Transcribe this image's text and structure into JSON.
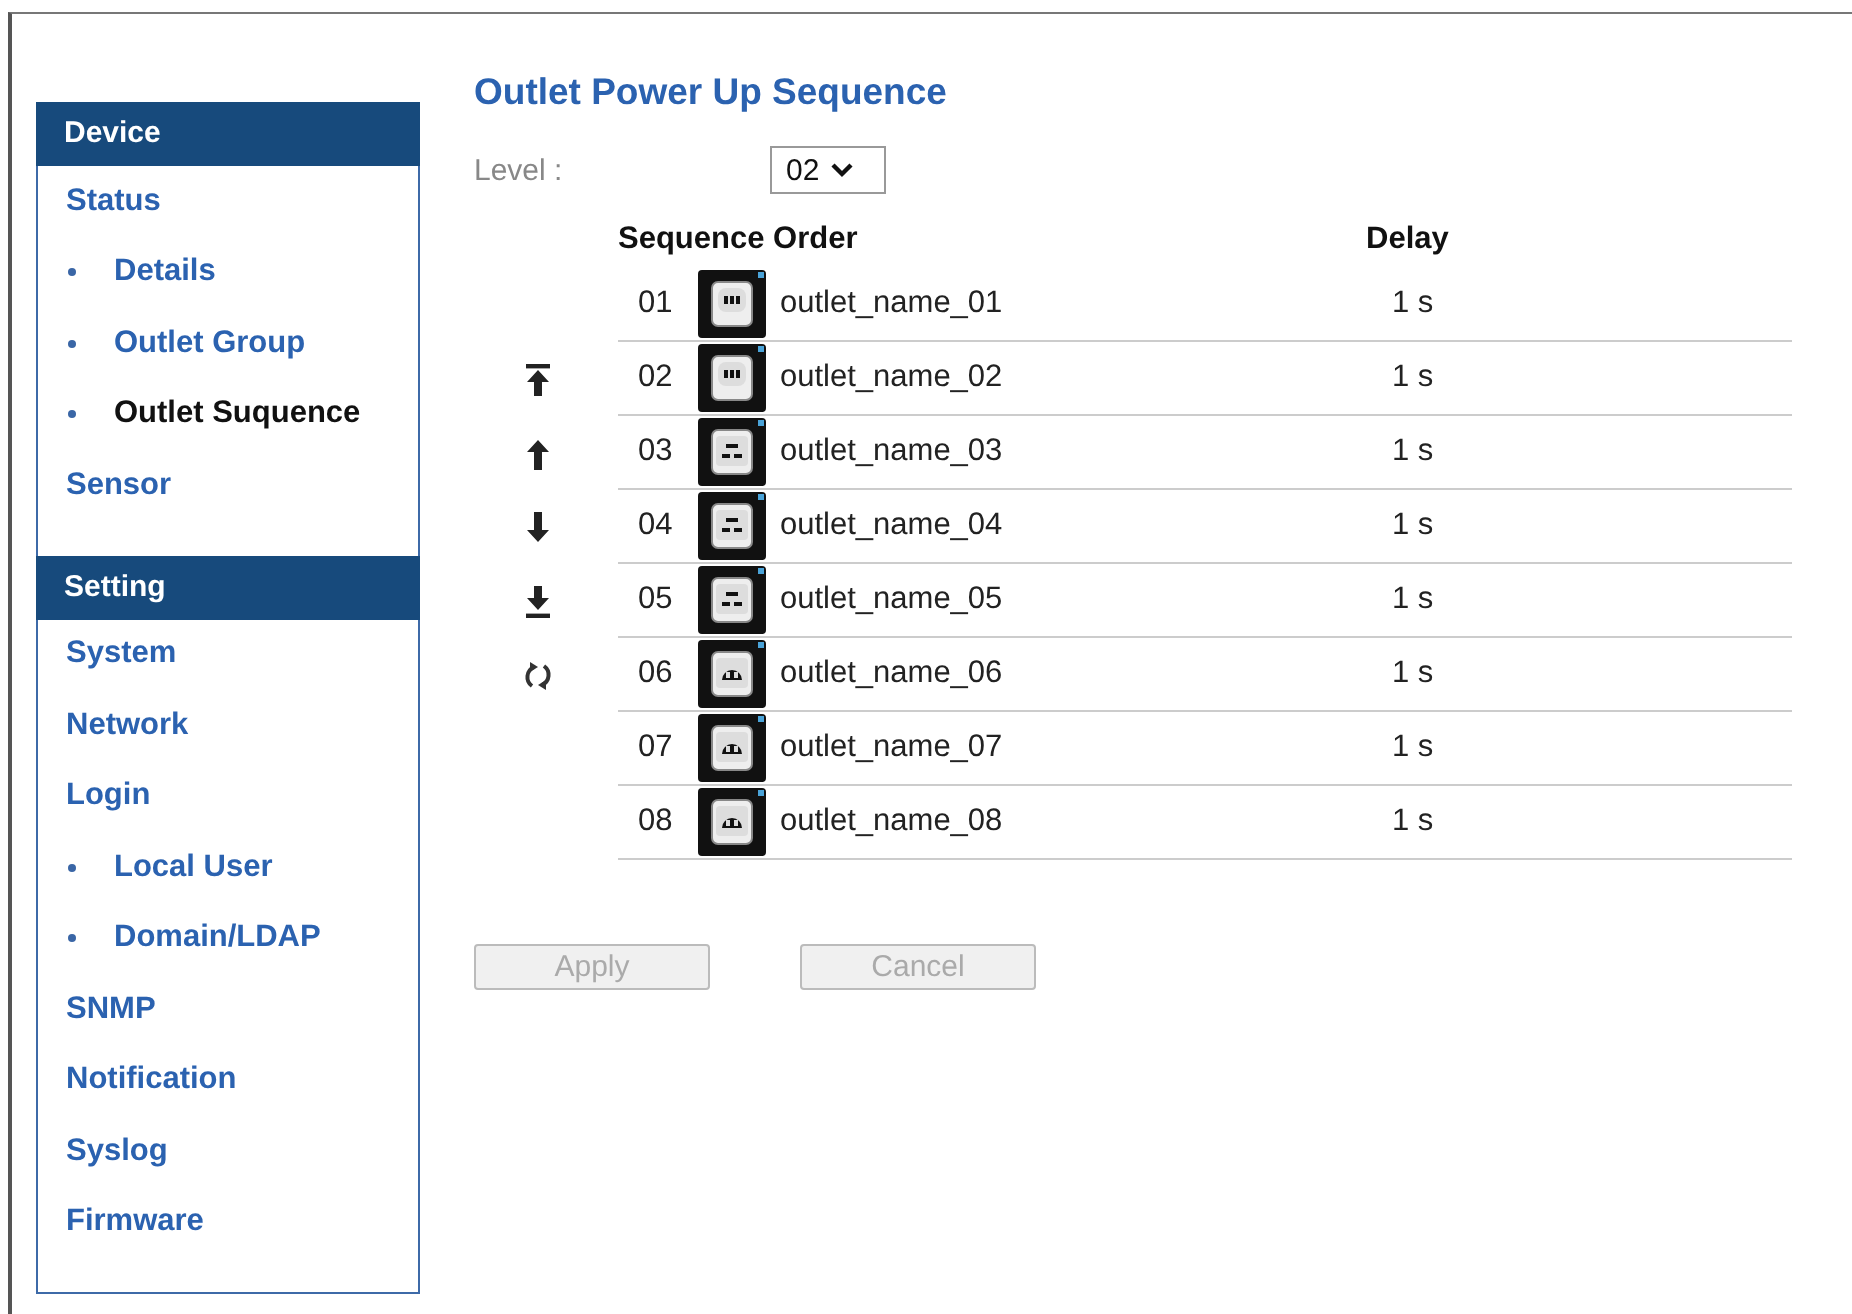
{
  "sidebar": {
    "sections": [
      {
        "title": "Device",
        "items": [
          {
            "label": "Status",
            "selected": false,
            "children": [
              {
                "label": "Details",
                "selected": false
              },
              {
                "label": "Outlet Group",
                "selected": false
              },
              {
                "label": "Outlet Suquence",
                "selected": true
              }
            ]
          },
          {
            "label": "Sensor",
            "selected": false
          }
        ]
      },
      {
        "title": "Setting",
        "items": [
          {
            "label": "System",
            "selected": false
          },
          {
            "label": "Network",
            "selected": false
          },
          {
            "label": "Login",
            "selected": false,
            "children": [
              {
                "label": "Local User",
                "selected": false
              },
              {
                "label": "Domain/LDAP",
                "selected": false
              }
            ]
          },
          {
            "label": "SNMP",
            "selected": false
          },
          {
            "label": "Notification",
            "selected": false
          },
          {
            "label": "Syslog",
            "selected": false
          },
          {
            "label": "Firmware",
            "selected": false
          }
        ]
      }
    ]
  },
  "page_title": "Outlet Power Up Sequence",
  "level": {
    "label": "Level :",
    "value": "02"
  },
  "reorder_tools": [
    {
      "kind": "top"
    },
    {
      "kind": "up"
    },
    {
      "kind": "down"
    },
    {
      "kind": "bottom"
    },
    {
      "kind": "reverse"
    }
  ],
  "table": {
    "columns": [
      "Sequence Order",
      "Delay"
    ],
    "rows": [
      {
        "order": "01",
        "kind": "c13",
        "name": "outlet_name_01",
        "delay": "1 s"
      },
      {
        "order": "02",
        "kind": "c13",
        "name": "outlet_name_02",
        "delay": "1 s"
      },
      {
        "order": "03",
        "kind": "c19",
        "name": "outlet_name_03",
        "delay": "1 s"
      },
      {
        "order": "04",
        "kind": "c19",
        "name": "outlet_name_04",
        "delay": "1 s"
      },
      {
        "order": "05",
        "kind": "c19",
        "name": "outlet_name_05",
        "delay": "1 s"
      },
      {
        "order": "06",
        "kind": "nema",
        "name": "outlet_name_06",
        "delay": "1 s"
      },
      {
        "order": "07",
        "kind": "nema",
        "name": "outlet_name_07",
        "delay": "1 s"
      },
      {
        "order": "08",
        "kind": "nema",
        "name": "outlet_name_08",
        "delay": "1 s"
      }
    ]
  },
  "buttons": [
    {
      "label": "Apply",
      "disabled": true
    },
    {
      "label": "Cancel",
      "disabled": true
    }
  ]
}
